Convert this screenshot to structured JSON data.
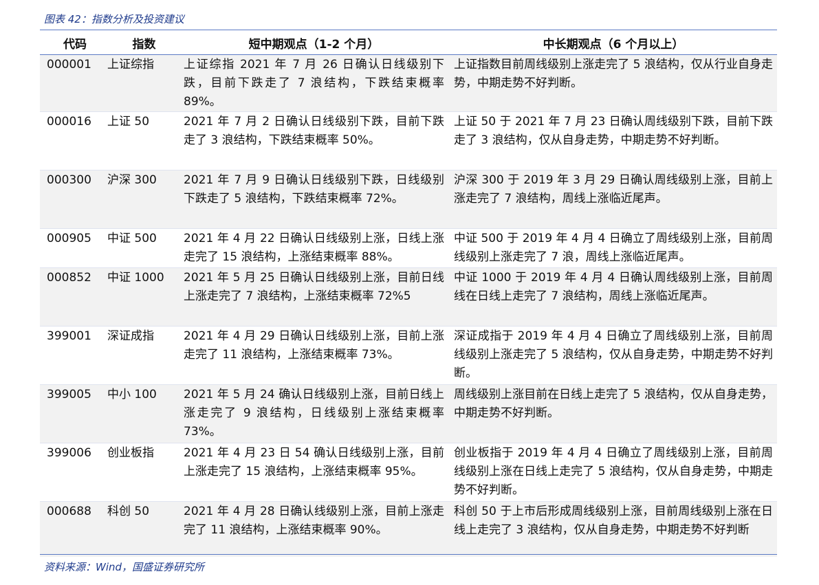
{
  "caption": "图表 42：指数分析及投资建议",
  "source": "资料来源：Wind，国盛证券研究所",
  "table": {
    "headers": [
      "代码",
      "指数",
      "短中期观点（1-2 个月）",
      "中长期观点（6 个月以上）"
    ],
    "rows": [
      {
        "code": "000001",
        "index": "上证综指",
        "short": "上证综指 2021 年 7 月 26 日确认日线级别下跌，目前下跌走了 7 浪结构，下跌结束概率 89%。",
        "long": "上证指数目前周线级别上涨走完了 5 浪结构，仅从行业自身走势，中期走势不好判断。"
      },
      {
        "code": "000016",
        "index": "上证 50",
        "short": "2021 年 7 月 2 日确认日线级别下跌，目前下跌走了 3 浪结构，下跌结束概率 50%。",
        "long": "上证 50 于 2021 年 7 月 23 日确认周线级别下跌，目前下跌走了 3 浪结构，仅从自身走势，中期走势不好判断。"
      },
      {
        "code": "000300",
        "index": "沪深 300",
        "short": "2021 年 7 月 9 日确认日线级别下跌，日线级别下跌走了 5 浪结构，下跌结束概率 72%。",
        "long": "沪深 300 于 2019 年 3 月 29 日确认周线级别上涨，目前上涨走完了 7 浪结构，周线上涨临近尾声。"
      },
      {
        "code": "000905",
        "index": "中证 500",
        "short": "2021 年 4 月 22 日确认日线级别上涨，日线上涨走完了 15 浪结构，上涨结束概率 88%。",
        "long": "中证 500 于 2019 年 4 月 4 日确立了周线级别上涨，目前周线级别上涨走完了 7 浪，周线上涨临近尾声。"
      },
      {
        "code": "000852",
        "index": "中证 1000",
        "short": "2021 年 5 月 25 日确认日线级别上涨，目前日线上涨走完了 7 浪结构，上涨结束概率 72%5",
        "long": "中证 1000 于 2019 年 4 月 4 日确认周线级别上涨，目前周线在日线上走完了 7 浪结构，周线上涨临近尾声。"
      },
      {
        "code": "399001",
        "index": "深证成指",
        "short": "2021 年 4 月 29 日确认日线级别上涨，目前上涨走完了 11 浪结构，上涨结束概率 73%。",
        "long": "深证成指于 2019 年 4 月 4 日确立了周线级别上涨，目前周线级别上涨走完了 5 浪结构，仅从自身走势，中期走势不好判断。"
      },
      {
        "code": "399005",
        "index": "中小 100",
        "short": "2021 年 5 月 24 确认日线级别上涨，目前日线上涨走完了 9 浪结构，日线级别上涨结束概率 73%。",
        "long": "周线级别上涨目前在日线上走完了 5 浪结构，仅从自身走势，中期走势不好判断。"
      },
      {
        "code": "399006",
        "index": "创业板指",
        "short": "2021 年 4 月 23 日 54 确认日线级别上涨，目前上涨走完了 15 浪结构，上涨结束概率 95%。",
        "long": "创业板指于 2019 年 4 月 4 日确立了周线级别上涨，目前周线级别上涨在日线上走完了 5 浪结构，仅从自身走势，中期走势不好判断。"
      },
      {
        "code": "000688",
        "index": "科创 50",
        "short": "2021 年 4 月 28 日确认线级别上涨，目前上涨走完了 11 浪结构，上涨结束概率 90%。",
        "long": "科创 50 于上市后形成周线级别上涨，目前周线级别上涨在日线上走完了 3 浪结构，仅从自身走势，中期走势不好判断"
      }
    ]
  }
}
